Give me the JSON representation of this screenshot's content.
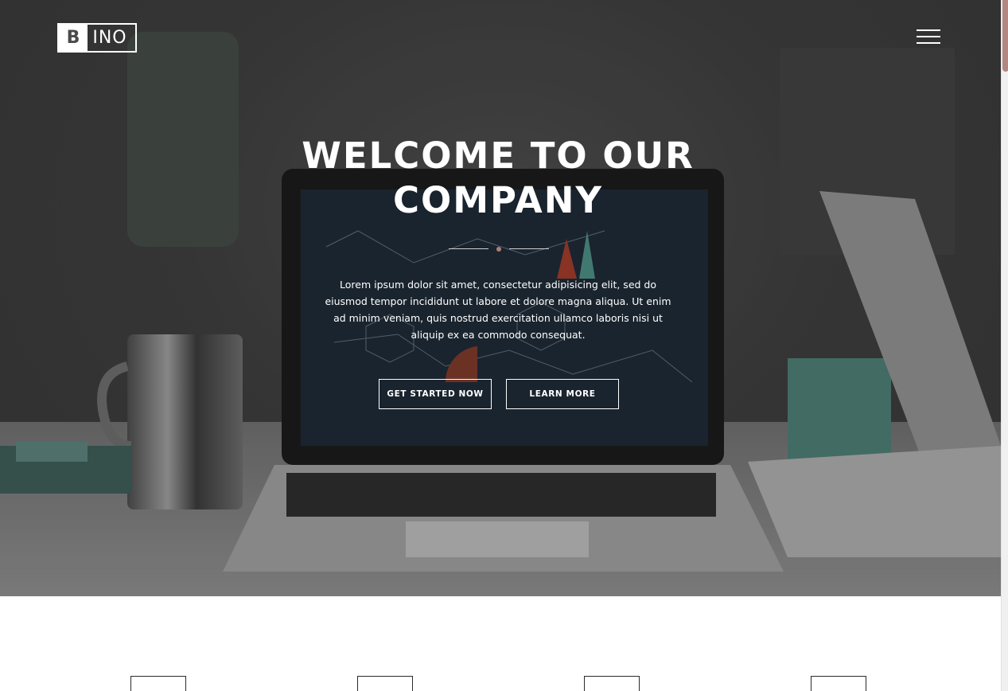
{
  "brand": {
    "logo_initial": "B",
    "logo_rest": "INO"
  },
  "nav": {
    "menu_icon": "hamburger-menu-icon"
  },
  "hero": {
    "title": "WELCOME TO OUR COMPANY",
    "text": "Lorem ipsum dolor sit amet, consectetur adipisicing elit, sed do eiusmod tempor incididunt ut labore et dolore magna aliqua. Ut enim ad minim veniam, quis nostrud exercitation ullamco laboris nisi ut aliquip ex ea commodo consequat.",
    "primary_button": "GET STARTED NOW",
    "secondary_button": "LEARN MORE",
    "divider_dot_color": "#b07e76"
  },
  "features": {
    "count": 4
  },
  "colors": {
    "accent": "#b08783",
    "text_on_hero": "#ffffff"
  }
}
